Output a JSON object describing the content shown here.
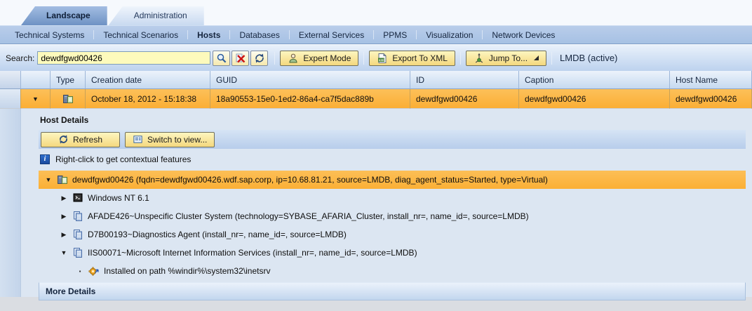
{
  "tabs": [
    {
      "label": "Landscape",
      "active": true
    },
    {
      "label": "Administration",
      "active": false
    }
  ],
  "nav": {
    "items": [
      "Technical Systems",
      "Technical Scenarios",
      "Hosts",
      "Databases",
      "External Services",
      "PPMS",
      "Visualization",
      "Network Devices"
    ],
    "active": "Hosts"
  },
  "toolbar": {
    "search_label": "Search:",
    "search_value": "dewdfgwd00426",
    "expert_mode_label": "Expert Mode",
    "export_xml_label": "Export To XML",
    "jump_to_label": "Jump To...",
    "status": "LMDB (active)"
  },
  "table": {
    "columns": [
      "Type",
      "Creation date",
      "GUID",
      "ID",
      "Caption",
      "Host Name"
    ],
    "row": {
      "creation_date": "October 18, 2012 - 15:18:38",
      "guid": "18a90553-15e0-1ed2-86a4-ca7f5dac889b",
      "id": "dewdfgwd00426",
      "caption": "dewdfgwd00426",
      "host_name": "dewdfgwd00426",
      "selected": true,
      "type_icon": "host-icon"
    }
  },
  "details": {
    "title": "Host Details",
    "refresh_label": "Refresh",
    "switch_view_label": "Switch to view...",
    "hint": "Right-click to get contextual features",
    "tree": {
      "items": [
        {
          "label": "dewdfgwd00426 (fqdn=dewdfgwd00426.wdf.sap.corp, ip=10.68.81.21, source=LMDB, diag_agent_status=Started, type=Virtual)",
          "level": 1,
          "expanded": true,
          "selected": true,
          "icon": "host-icon"
        },
        {
          "label": "Windows NT 6.1",
          "level": 2,
          "expanded": false,
          "selected": false,
          "icon": "operating-system-icon"
        },
        {
          "label": "AFADE426~Unspecific Cluster System (technology=SYBASE_AFARIA_Cluster, install_nr=, name_id=, source=LMDB)",
          "level": 2,
          "expanded": false,
          "selected": false,
          "icon": "technical-system-icon"
        },
        {
          "label": "D7B00193~Diagnostics Agent (install_nr=, name_id=, source=LMDB)",
          "level": 2,
          "expanded": false,
          "selected": false,
          "icon": "technical-system-icon"
        },
        {
          "label": "IIS00071~Microsoft Internet Information Services (install_nr=, name_id=, source=LMDB)",
          "level": 2,
          "expanded": true,
          "selected": false,
          "icon": "technical-system-icon"
        },
        {
          "label": "Installed on path %windir%\\system32\\inetsrv",
          "level": 3,
          "expanded": null,
          "selected": false,
          "icon": "installed-path-icon"
        }
      ]
    },
    "more_details_label": "More Details"
  },
  "glyphs": {
    "expanded": "▼",
    "collapsed": "▶",
    "bullet": "▪"
  },
  "colors": {
    "selection_orange": "#FBB23C",
    "button_yellow": "#F6E096",
    "navbar_blue": "#AEC7E8",
    "accent_blue": "#2C5D9C",
    "search_field_yellow": "#FDFABC"
  }
}
